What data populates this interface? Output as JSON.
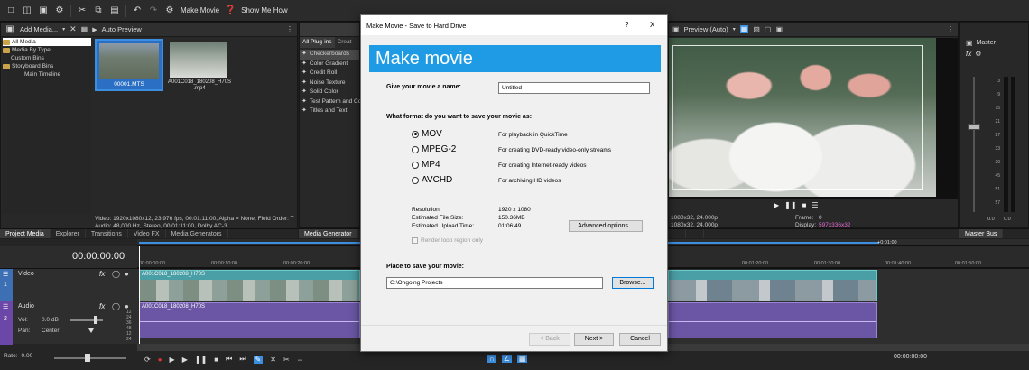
{
  "toolbar": {
    "make_movie_label": "Make Movie",
    "show_me_how_label": "Show Me How"
  },
  "media_panel": {
    "add_media_label": "Add Media...",
    "auto_preview_label": "Auto Preview",
    "tree": [
      {
        "label": "All Media",
        "selected": true
      },
      {
        "label": "Media By Type",
        "selected": false
      },
      {
        "label": "Custom Bins",
        "selected": false
      },
      {
        "label": "Storyboard Bins",
        "selected": false
      },
      {
        "label": "Main Timeline",
        "selected": false
      }
    ],
    "clips": [
      {
        "name": "00001.MTS",
        "selected": true
      },
      {
        "name": "A001C018_180208_H70S .mp4",
        "selected": false
      }
    ],
    "info_line1": "Video: 1920x1080x12, 23.976 fps, 00:01:11:00, Alpha = None, Field Order: T",
    "info_line2": "Audio: 48,000 Hz, Stereo, 00:01:11:00, Dolby AC-3"
  },
  "left_tabs": [
    "Project Media",
    "Explorer",
    "Transitions",
    "Video FX",
    "Media Generators"
  ],
  "plugins_panel": {
    "tab_all": "All Plug-ins",
    "tab_other": "Creat",
    "items": [
      "Checkerboards",
      "Color Gradient",
      "Credit Roll",
      "Noise Texture",
      "Solid Color",
      "Test Pattern and Co",
      "Titles and Text"
    ]
  },
  "plugins_tab": "Media Generator",
  "preview_panel": {
    "preview_label": "Preview (Auto)",
    "info_left_line1": "1080x32, 24.000p",
    "info_left_line2": "1080x32, 24.000p",
    "frame_label": "Frame:",
    "frame_value": "0",
    "display_label": "Display:",
    "display_value": "597x336x32"
  },
  "master_panel": {
    "title": "Master",
    "fx_label": "fx",
    "scale": [
      "3",
      "9",
      "15",
      "21",
      "27",
      "33",
      "39",
      "45",
      "51",
      "57"
    ],
    "bottom_left": "0.0",
    "bottom_right": "0.0",
    "tab": "Master Bus"
  },
  "timeline": {
    "timecode": "00:00:00:00",
    "ruler": [
      "00:00:00:00",
      "00:00:10:00",
      "00:00:20:00",
      "00:01:20:00",
      "00:01:30:00",
      "00:01:40:00",
      "00:01:50:00"
    ],
    "ruler_end": "+0:01:00",
    "video_track": {
      "name": "Video",
      "number": "1",
      "clip": "A001C018_180208_H70S"
    },
    "audio_track": {
      "name": "Audio",
      "number": "2",
      "vol_label": "Vol:",
      "vol_value": "0.0 dB",
      "pan_label": "Pan:",
      "pan_value": "Center",
      "clip": "A001C018_180208_H70S"
    },
    "db_scale": [
      "12",
      "24",
      "36",
      "48",
      "12",
      "24",
      "36",
      "48"
    ],
    "rate_label": "Rate:",
    "rate_value": "0.00",
    "right_time": "00:00:00:00"
  },
  "dialog": {
    "title": "Make Movie - Save to Hard Drive",
    "help": "?",
    "close": "X",
    "banner": "Make movie",
    "name_prompt": "Give your movie a name:",
    "name_value": "Untitled",
    "format_prompt": "What format do you want to save your movie as:",
    "formats": [
      {
        "label": "MOV",
        "desc": "For playback in QuickTime",
        "selected": true
      },
      {
        "label": "MPEG-2",
        "desc": "For creating DVD-ready video-only streams",
        "selected": false
      },
      {
        "label": "MP4",
        "desc": "For creating Internet-ready videos",
        "selected": false
      },
      {
        "label": "AVCHD",
        "desc": "For archiving HD videos",
        "selected": false
      }
    ],
    "resolution_label": "Resolution:",
    "resolution_value": "1920 x 1080",
    "file_size_label": "Estimated File Size:",
    "file_size_value": "150.36MB",
    "upload_label": "Estimated Upload Time:",
    "upload_value": "01:06:49",
    "advanced_label": "Advanced options...",
    "loop_label": "Render loop region only",
    "place_prompt": "Place to save your movie:",
    "path_value": "G:\\Ongoing Projects",
    "browse_label": "Browse...",
    "back_label": "< Back",
    "next_label": "Next >",
    "cancel_label": "Cancel"
  }
}
